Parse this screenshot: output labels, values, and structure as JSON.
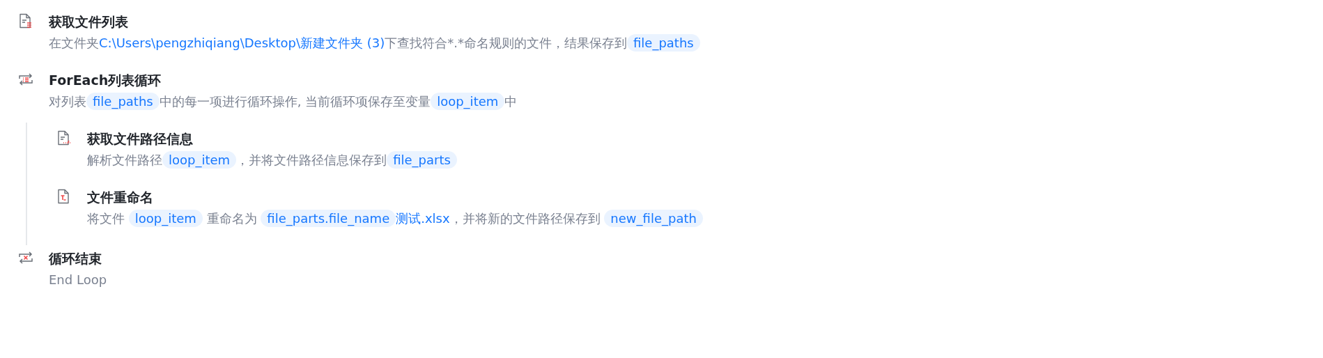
{
  "steps": [
    {
      "kind": "file-list",
      "title": "获取文件列表",
      "description": [
        {
          "kind": "text",
          "text": "在文件夹"
        },
        {
          "kind": "path",
          "text": "C:\\Users\\pengzhiqiang\\Desktop\\新建文件夹 (3)"
        },
        {
          "kind": "text",
          "text": "下查找符合*.*命名规则的文件，结果保存到"
        },
        {
          "kind": "variable",
          "text": "file_paths"
        }
      ]
    },
    {
      "kind": "loop",
      "title": "ForEach列表循环",
      "description": [
        {
          "kind": "text",
          "text": "对列表"
        },
        {
          "kind": "variable",
          "text": "file_paths"
        },
        {
          "kind": "text",
          "text": "中的每一项进行循环操作, 当前循环项保存至变量"
        },
        {
          "kind": "variable",
          "text": "loop_item"
        },
        {
          "kind": "text",
          "text": "中"
        }
      ],
      "children": [
        {
          "kind": "file-path",
          "title": "获取文件路径信息",
          "description": [
            {
              "kind": "text",
              "text": "解析文件路径"
            },
            {
              "kind": "variable",
              "text": "loop_item"
            },
            {
              "kind": "text",
              "text": "，并将文件路径信息保存到"
            },
            {
              "kind": "variable",
              "text": "file_parts"
            }
          ]
        },
        {
          "kind": "file-rename",
          "title": "文件重命名",
          "description": [
            {
              "kind": "text",
              "text": "将文件 "
            },
            {
              "kind": "variable",
              "text": "loop_item"
            },
            {
              "kind": "text",
              "text": " 重命名为 "
            },
            {
              "kind": "variable",
              "text": "file_parts.file_name"
            },
            {
              "kind": "path",
              "text": "测试.xlsx"
            },
            {
              "kind": "text",
              "text": "，并将新的文件路径保存到 "
            },
            {
              "kind": "variable",
              "text": "new_file_path"
            }
          ]
        }
      ]
    },
    {
      "kind": "loop-end",
      "title": "循环结束",
      "description": [
        {
          "kind": "text",
          "text": "End Loop"
        }
      ]
    }
  ]
}
